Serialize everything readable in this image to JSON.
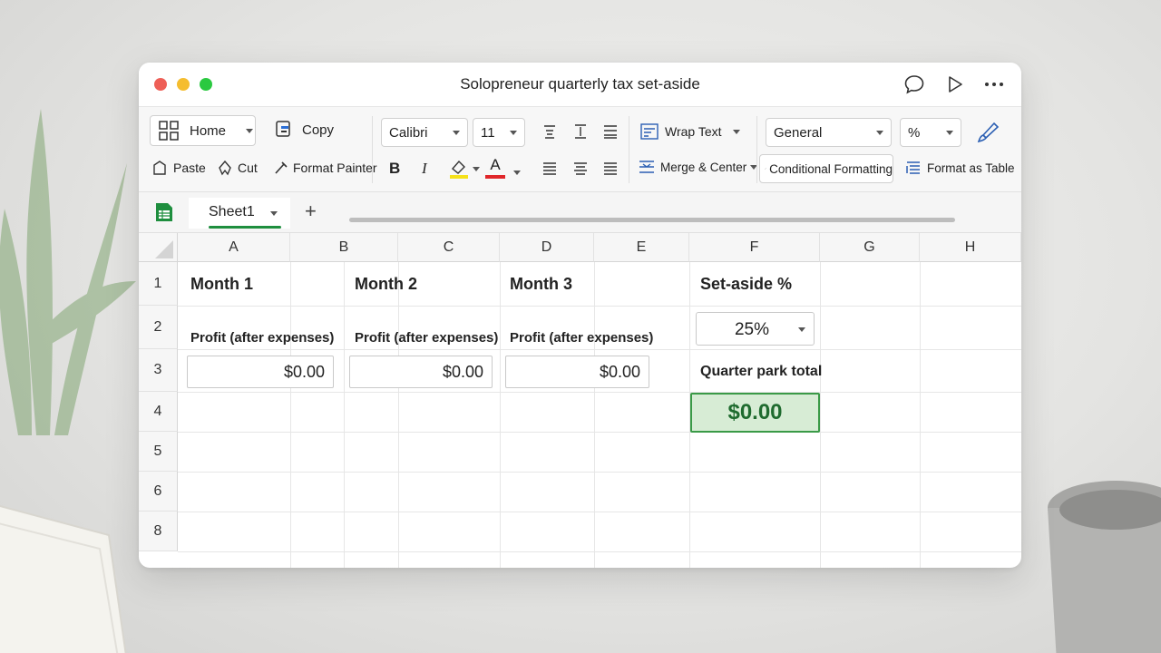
{
  "window": {
    "title": "Solopreneur quarterly tax set-aside"
  },
  "ribbon": {
    "home_label": "Home",
    "copy_label": "Copy",
    "paste_label": "Paste",
    "cut_label": "Cut",
    "format_painter_label": "Format Painter",
    "font_name": "Calibri",
    "font_size": "11",
    "bold_label": "B",
    "italic_label": "I",
    "font_color_label": "A",
    "wrap_text_label": "Wrap Text",
    "merge_center_label": "Merge & Center",
    "number_format": "General",
    "percent_label": "%",
    "conditional_formatting_label": "Conditional Formatting",
    "format_as_table_label": "Format as Table",
    "highlight_color": "#f5e11a",
    "font_color": "#e0262a"
  },
  "tabs": {
    "sheet_name": "Sheet1",
    "add_label": "+"
  },
  "grid": {
    "columns": [
      "A",
      "B",
      "C",
      "D",
      "E",
      "F",
      "G",
      "H"
    ],
    "rows": [
      "1",
      "2",
      "3",
      "4",
      "5",
      "6",
      "8"
    ],
    "month1_label": "Month 1",
    "month2_label": "Month 2",
    "month3_label": "Month 3",
    "setaside_label": "Set-aside %",
    "profit_label_1": "Profit (after expenses)",
    "profit_label_2": "Profit (after expenses)",
    "profit_label_3": "Profit (after expenses)",
    "month1_value": "$0.00",
    "month2_value": "$0.00",
    "month3_value": "$0.00",
    "setaside_value": "25%",
    "total_label": "Quarter park total",
    "total_value": "$0.00"
  },
  "colors": {
    "accent_green": "#1e8e3e",
    "total_fill": "#d7ecd5"
  }
}
